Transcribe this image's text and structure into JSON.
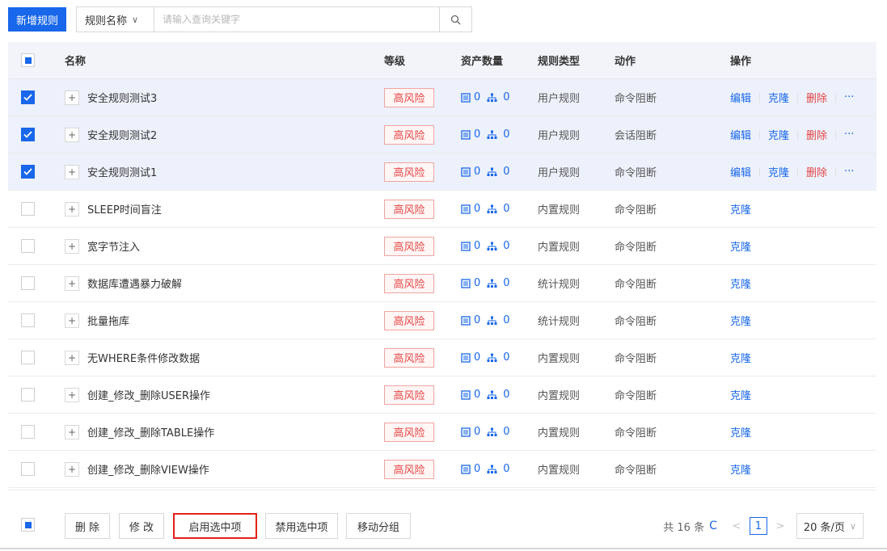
{
  "toolbar": {
    "add_rule": "新增规则",
    "field_select": "规则名称",
    "search_placeholder": "请输入查询关键字"
  },
  "table": {
    "headers": {
      "name": "名称",
      "level": "等级",
      "assets": "资产数量",
      "type": "规则类型",
      "action": "动作",
      "ops": "操作"
    },
    "rows": [
      {
        "name": "安全规则测试3",
        "level": "高风险",
        "assets_db": "0",
        "assets_group": "0",
        "type": "用户规则",
        "action": "命令阻断",
        "selected": true,
        "ops": [
          "编辑",
          "克隆",
          "删除",
          "···"
        ]
      },
      {
        "name": "安全规则测试2",
        "level": "高风险",
        "assets_db": "0",
        "assets_group": "0",
        "type": "用户规则",
        "action": "会话阻断",
        "selected": true,
        "ops": [
          "编辑",
          "克隆",
          "删除",
          "···"
        ]
      },
      {
        "name": "安全规则测试1",
        "level": "高风险",
        "assets_db": "0",
        "assets_group": "0",
        "type": "用户规则",
        "action": "命令阻断",
        "selected": true,
        "ops": [
          "编辑",
          "克隆",
          "删除",
          "···"
        ]
      },
      {
        "name": "SLEEP时间盲注",
        "level": "高风险",
        "assets_db": "0",
        "assets_group": "0",
        "type": "内置规则",
        "action": "命令阻断",
        "selected": false,
        "ops": [
          "克隆"
        ]
      },
      {
        "name": "宽字节注入",
        "level": "高风险",
        "assets_db": "0",
        "assets_group": "0",
        "type": "内置规则",
        "action": "命令阻断",
        "selected": false,
        "ops": [
          "克隆"
        ]
      },
      {
        "name": "数据库遭遇暴力破解",
        "level": "高风险",
        "assets_db": "0",
        "assets_group": "0",
        "type": "统计规则",
        "action": "命令阻断",
        "selected": false,
        "ops": [
          "克隆"
        ]
      },
      {
        "name": "批量拖库",
        "level": "高风险",
        "assets_db": "0",
        "assets_group": "0",
        "type": "统计规则",
        "action": "命令阻断",
        "selected": false,
        "ops": [
          "克隆"
        ]
      },
      {
        "name": "无WHERE条件修改数据",
        "level": "高风险",
        "assets_db": "0",
        "assets_group": "0",
        "type": "内置规则",
        "action": "命令阻断",
        "selected": false,
        "ops": [
          "克隆"
        ]
      },
      {
        "name": "创建_修改_删除USER操作",
        "level": "高风险",
        "assets_db": "0",
        "assets_group": "0",
        "type": "内置规则",
        "action": "命令阻断",
        "selected": false,
        "ops": [
          "克隆"
        ]
      },
      {
        "name": "创建_修改_删除TABLE操作",
        "level": "高风险",
        "assets_db": "0",
        "assets_group": "0",
        "type": "内置规则",
        "action": "命令阻断",
        "selected": false,
        "ops": [
          "克隆"
        ]
      },
      {
        "name": "创建_修改_删除VIEW操作",
        "level": "高风险",
        "assets_db": "0",
        "assets_group": "0",
        "type": "内置规则",
        "action": "命令阻断",
        "selected": false,
        "ops": [
          "克隆"
        ]
      }
    ]
  },
  "footer": {
    "delete": "删 除",
    "modify": "修 改",
    "enable_selected": "启用选中项",
    "disable_selected": "禁用选中项",
    "move_group": "移动分组",
    "total": "共 16 条",
    "page": "1",
    "page_size": "20 条/页"
  },
  "colors": {
    "primary": "#1967ea",
    "danger": "#e54545",
    "highlight_border": "#e3211b"
  }
}
